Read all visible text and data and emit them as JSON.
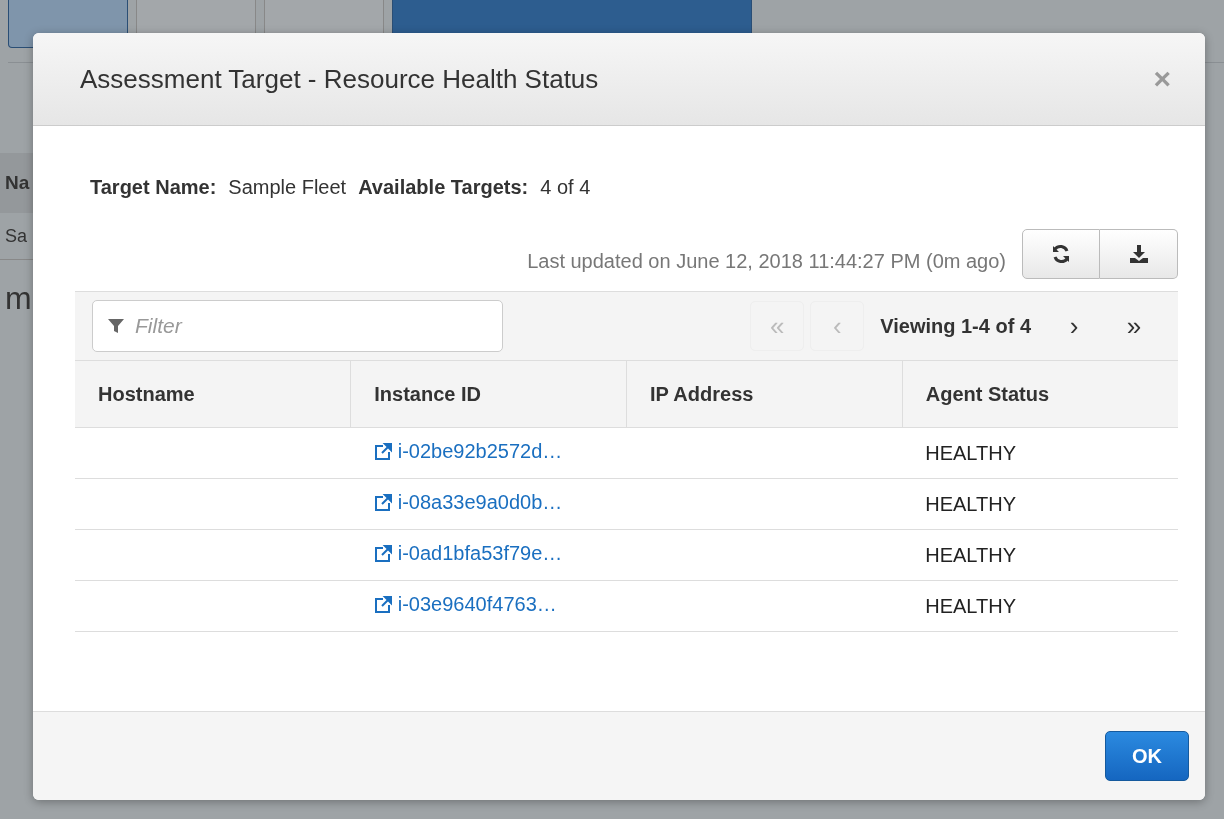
{
  "background": {
    "toolbar": [
      {
        "kind": "muted"
      },
      {
        "kind": "default"
      },
      {
        "kind": "default"
      },
      {
        "kind": "primary"
      }
    ],
    "column_header": "Na",
    "cell": "Sa",
    "heading": "m"
  },
  "dialog": {
    "title": "Assessment Target - Resource Health Status",
    "close": "×",
    "summary": [
      {
        "label": "Target Name:",
        "value": "Sample Fleet"
      },
      {
        "label": "Available Targets:",
        "value": "4 of 4"
      }
    ],
    "last_updated": "Last updated on June 12, 2018 11:44:27 PM (0m ago)",
    "filter": {
      "placeholder": "Filter"
    },
    "pager": [
      {
        "label": "«",
        "disabled": true
      },
      {
        "label": "‹",
        "disabled": true
      },
      {
        "label": "Viewing 1-4 of 4",
        "kind": "text"
      },
      {
        "label": "›",
        "disabled": false
      },
      {
        "label": "»",
        "disabled": false
      }
    ],
    "table": {
      "columns": [
        "Hostname",
        "Instance ID",
        "IP Address",
        "Agent Status"
      ],
      "rows": [
        {
          "instance_id": "i-02be92b2572d…",
          "status": "HEALTHY"
        },
        {
          "instance_id": "i-08a33e9a0d0b…",
          "status": "HEALTHY"
        },
        {
          "instance_id": "i-0ad1bfa53f79e…",
          "status": "HEALTHY"
        },
        {
          "instance_id": "i-03e9640f4763…",
          "status": "HEALTHY"
        }
      ]
    },
    "ok_button": "OK"
  }
}
